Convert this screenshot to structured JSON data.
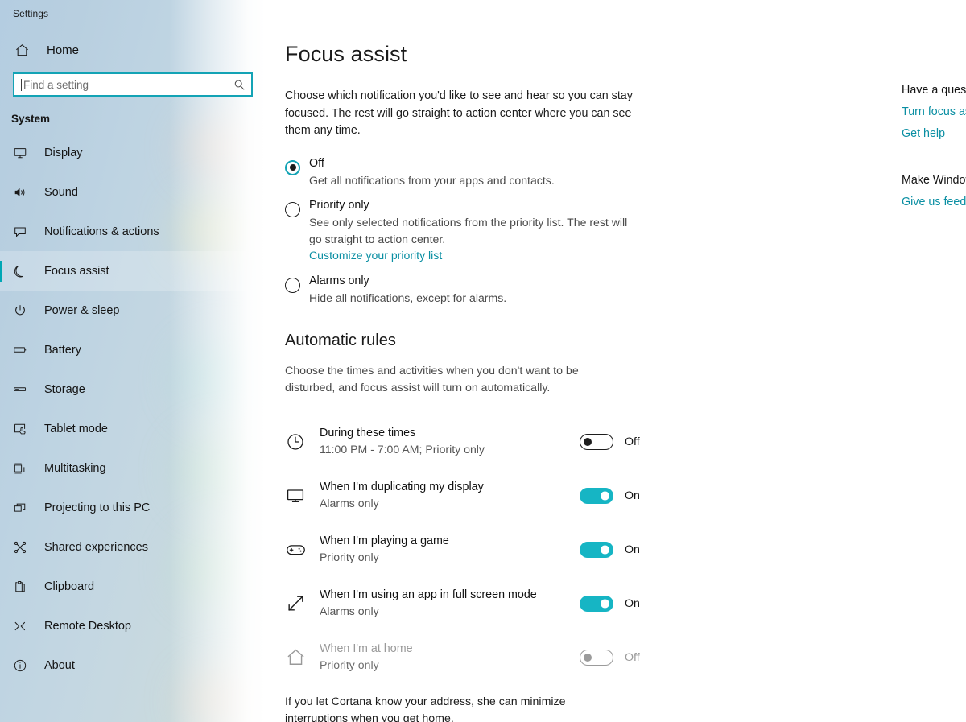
{
  "window": {
    "app_title": "Settings"
  },
  "sidebar": {
    "home_label": "Home",
    "home_icon": "home-icon",
    "search": {
      "placeholder": "Find a setting",
      "value": "",
      "icon": "search-icon"
    },
    "group_label": "System",
    "accent_color": "#00a7b5",
    "items": [
      {
        "label": "Display",
        "icon": "monitor-icon",
        "selected": false
      },
      {
        "label": "Sound",
        "icon": "speaker-icon",
        "selected": false
      },
      {
        "label": "Notifications & actions",
        "icon": "chat-bubble-icon",
        "selected": false
      },
      {
        "label": "Focus assist",
        "icon": "moon-icon",
        "selected": true
      },
      {
        "label": "Power & sleep",
        "icon": "power-icon",
        "selected": false
      },
      {
        "label": "Battery",
        "icon": "battery-icon",
        "selected": false
      },
      {
        "label": "Storage",
        "icon": "storage-icon",
        "selected": false
      },
      {
        "label": "Tablet mode",
        "icon": "tablet-touch-icon",
        "selected": false
      },
      {
        "label": "Multitasking",
        "icon": "multitasking-icon",
        "selected": false
      },
      {
        "label": "Projecting to this PC",
        "icon": "project-screen-icon",
        "selected": false
      },
      {
        "label": "Shared experiences",
        "icon": "share-nodes-icon",
        "selected": false
      },
      {
        "label": "Clipboard",
        "icon": "clipboard-icon",
        "selected": false
      },
      {
        "label": "Remote Desktop",
        "icon": "remote-desktop-icon",
        "selected": false
      },
      {
        "label": "About",
        "icon": "info-icon",
        "selected": false
      }
    ]
  },
  "main": {
    "title": "Focus assist",
    "description": "Choose which notification you'd like to see and hear so you can stay focused. The rest will go straight to action center where you can see them any time.",
    "radio_options": [
      {
        "label": "Off",
        "sub": "Get all notifications from your apps and contacts.",
        "checked": true,
        "link": null
      },
      {
        "label": "Priority only",
        "sub": "See only selected notifications from the priority list. The rest will go straight to action center.",
        "checked": false,
        "link": "Customize your priority list"
      },
      {
        "label": "Alarms only",
        "sub": "Hide all notifications, except for alarms.",
        "checked": false,
        "link": null
      }
    ],
    "automatic_rules": {
      "title": "Automatic rules",
      "description": "Choose the times and activities when you don't want to be disturbed, and focus assist will turn on automatically.",
      "rules": [
        {
          "title": "During these times",
          "sub": "11:00 PM - 7:00 AM; Priority only",
          "icon": "clock-icon",
          "state": "Off",
          "on": false,
          "disabled": false
        },
        {
          "title": "When I'm duplicating my display",
          "sub": "Alarms only",
          "icon": "monitor-icon",
          "state": "On",
          "on": true,
          "disabled": false
        },
        {
          "title": "When I'm playing a game",
          "sub": "Priority only",
          "icon": "gamepad-icon",
          "state": "On",
          "on": true,
          "disabled": false
        },
        {
          "title": "When I'm using an app in full screen mode",
          "sub": "Alarms only",
          "icon": "fullscreen-arrows-icon",
          "state": "On",
          "on": true,
          "disabled": false
        },
        {
          "title": "When I'm at home",
          "sub": "Priority only",
          "icon": "house-icon",
          "state": "Off",
          "on": false,
          "disabled": true
        }
      ],
      "footnote": "If you let Cortana know your address, she can minimize interruptions when you get home."
    }
  },
  "right_pane": {
    "help_heading": "Have a question?",
    "help_links": [
      "Turn focus assist on or off",
      "Get help"
    ],
    "feedback_heading": "Make Windows better",
    "feedback_links": [
      "Give us feedback"
    ]
  },
  "colors": {
    "accent": "#00a7b5",
    "link": "#0b8fa3",
    "toggle_on": "#16b5c4",
    "sidebar_top": "#b4cde1"
  }
}
